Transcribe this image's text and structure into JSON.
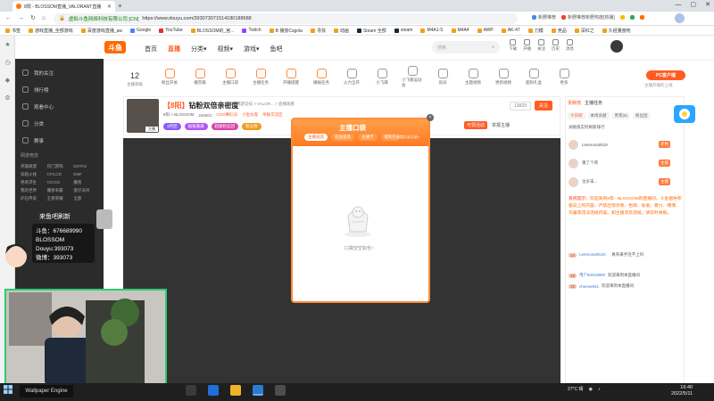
{
  "browser": {
    "tab_title": "8阳 - BLOSSOM直播_VALORANT直播",
    "new_tab": "+",
    "controls": [
      "—",
      "▢",
      "✕"
    ],
    "secure_label": "虚拟斗鱼网络科技有限公司 [CN]",
    "url": "https://www.douyu.com/393073071514180188688",
    "extensions": [
      {
        "label": "新野推荐",
        "color": "#4285f4"
      },
      {
        "label": "新野推荐新野热度[热播]",
        "color": "#ea4335"
      },
      {
        "label": "",
        "color": "#fbbc05"
      },
      {
        "label": "",
        "color": "#34a853"
      },
      {
        "label": "",
        "color": "#ff6a00"
      }
    ],
    "bookmarks": [
      "书签",
      "游戏直播_全部游戏",
      "百度游戏直播_aw",
      "Google",
      "YouTube",
      "BLOSSOM的_官...",
      "Twitch",
      "B 播放Csgola",
      "寻找",
      "动画",
      "Steam 全部",
      "steam",
      "M4A1-S",
      "M4A4",
      "AWP",
      "AK-47",
      "刀模",
      "竞品",
      "深红之",
      "久经量度枪"
    ]
  },
  "douyu": {
    "logo": "斗鱼",
    "nav": [
      {
        "label": "首页",
        "active": false
      },
      {
        "label": "直播",
        "active": true
      },
      {
        "label": "分类▾",
        "active": false
      },
      {
        "label": "视频▾",
        "active": false
      },
      {
        "label": "游戏▾",
        "active": false
      },
      {
        "label": "鱼吧",
        "active": false
      }
    ],
    "search_placeholder": "搜索",
    "top_icons": [
      "下载",
      "开播",
      "关注",
      "历史",
      "消息"
    ],
    "level_num": "12",
    "level_label": "主播等级",
    "features": [
      "粉丝开关",
      "播音箱",
      "主播口袋",
      "主播任务",
      "开播提醒",
      "播报任务",
      "火力全开",
      "小飞碟",
      "小飞碟运动会",
      "房间",
      "主题视频",
      "更新视频",
      "超粉礼盒",
      "更多"
    ],
    "pc_btn": "PC客户端",
    "pc_sub": "主播开播的上线"
  },
  "sidebar": {
    "items": [
      {
        "icon": "heart-icon",
        "label": "我的关注"
      },
      {
        "icon": "rank-icon",
        "label": "排行榜"
      },
      {
        "icon": "video-icon",
        "label": "观看中心"
      },
      {
        "icon": "list-icon",
        "label": "分类"
      },
      {
        "icon": "video-icon",
        "label": "赛事"
      }
    ],
    "section": "网游竞技",
    "grid": [
      "英雄联盟",
      "热门游戏",
      "DOTA2",
      "穿越火线",
      "CF/LCD",
      "DNF",
      "绝地求生",
      "CS:GO",
      "魔兽",
      "我的世界",
      "魔兽争霸",
      "蛋仔派对",
      "炉石传说",
      "王者荣耀",
      "全部"
    ]
  },
  "room": {
    "level_tag": "【8阳】",
    "title": "钻粉双倍亲密度",
    "meta": [
      "举报",
      "网游竞技 > VALOR... > 直播观看"
    ],
    "sub": [
      "8阳 > BLOSSOM",
      "240601",
      "CGG赛队员",
      "小鱼丸观",
      "举报交流区"
    ],
    "badges": [
      {
        "label": "3月团",
        "color": "#8a5cf5"
      },
      {
        "label": "福福满满",
        "color": "#b455f0"
      },
      {
        "label": "超级粉丝团",
        "color": "#d946a8"
      },
      {
        "label": "粉丝牌",
        "color": "#f29a1a"
      }
    ],
    "rank": "可领活动",
    "report": "举报主播",
    "anchor_tag": "主播",
    "follow_count": "13829",
    "follow": "关注"
  },
  "popup": {
    "title": "主播口袋",
    "tabs": [
      {
        "label": "主播道具",
        "active": true
      },
      {
        "label": "权益道具",
        "active": false
      },
      {
        "label": "主播卡",
        "active": false
      },
      {
        "label": "福利包",
        "active": false
      }
    ],
    "more": "查看历史记录>",
    "empty_text": "口袋空空如也~",
    "close": "×"
  },
  "right": {
    "head": [
      "贡献榜",
      "主播任务"
    ],
    "tabs": [
      {
        "label": "今日榜",
        "active": true
      },
      {
        "label": "本周贡献",
        "active": false
      },
      {
        "label": "贵宾(6)",
        "active": false
      },
      {
        "label": "粉丝团",
        "active": false
      }
    ],
    "caption": "贡献值实时刷新排行",
    "ranks": [
      {
        "name": "Leemona0519",
        "lv": "赤色"
      },
      {
        "name": "重了个哥",
        "lv": "主播"
      },
      {
        "name": "沈岁末...",
        "lv": "主播"
      }
    ],
    "notice_head": "系统提示：",
    "notice": "欢迎来到8阳 - BLOSSOM的直播间。斗鱼倡导积极向上的内容，严禁出现涉政、色情、低俗、暴力、赌博、诈骗等违法违规内容。如主播涉及违规，请及时举报。",
    "chat": [
      {
        "lv": "14",
        "name": "Leemona0519：",
        "text": "真有来手连不上吗"
      },
      {
        "lv": "18",
        "name": "用户93418900",
        "text": "欢迎来到本直播间"
      },
      {
        "lv": "15",
        "name": "cheese841",
        "text": "欢迎来到本直播间"
      }
    ]
  },
  "overlay": {
    "banner": "来鱼吧刷新",
    "ids": [
      "斗鱼：676689990",
      "BLOSSOM",
      "Douyu:393073",
      "微博：393073"
    ]
  },
  "taskbar": {
    "tray_text": "27°C 晴",
    "time": "16:40",
    "date": "2022/5/11",
    "wallpaper_btn": "Wallpaper Engine"
  }
}
